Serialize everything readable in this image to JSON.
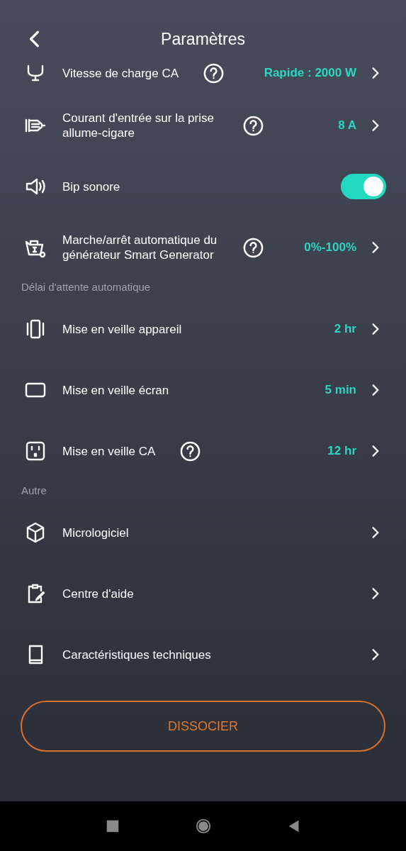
{
  "header": {
    "title": "Paramètres"
  },
  "sections": [
    {
      "rows": [
        {
          "kind": "link",
          "label": "Vitesse de charge CA",
          "help": true,
          "value": "Rapide : 2000 W"
        },
        {
          "kind": "link",
          "label": "Courant d'entrée sur la prise allume-cigare",
          "help": true,
          "value": "8 A"
        },
        {
          "kind": "toggle",
          "label": "Bip sonore",
          "help": false,
          "on": true
        },
        {
          "kind": "link",
          "label": "Marche/arrêt automatique du générateur Smart Generator",
          "help": true,
          "value": "0%-100%"
        }
      ]
    },
    {
      "title": "Délai d'attente automatique",
      "rows": [
        {
          "kind": "link",
          "label": "Mise en veille appareil",
          "help": false,
          "value": "2 hr"
        },
        {
          "kind": "link",
          "label": "Mise en veille écran",
          "help": false,
          "value": "5 min"
        },
        {
          "kind": "link",
          "label": "Mise en veille CA",
          "help": true,
          "value": "12 hr"
        }
      ]
    },
    {
      "title": "Autre",
      "rows": [
        {
          "kind": "link",
          "label": "Micrologiciel",
          "help": false
        },
        {
          "kind": "link",
          "label": "Centre d'aide",
          "help": false
        },
        {
          "kind": "link",
          "label": "Caractéristiques techniques",
          "help": false
        }
      ]
    }
  ],
  "unpair_button": "DISSOCIER"
}
